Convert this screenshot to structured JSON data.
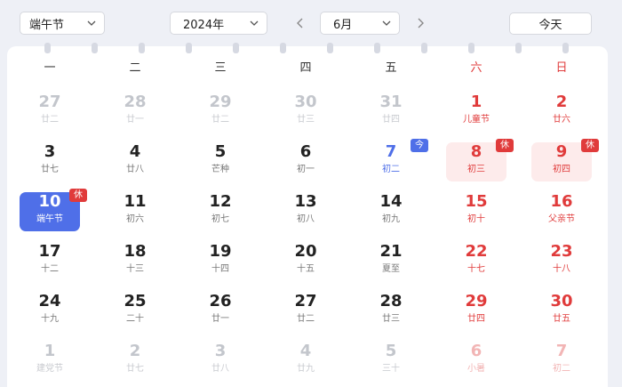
{
  "toolbar": {
    "holiday_select": {
      "value": "端午节"
    },
    "year_select": {
      "value": "2024年"
    },
    "month_select": {
      "value": "6月"
    },
    "prev_icon": "chevron-left-icon",
    "next_icon": "chevron-right-icon",
    "today_label": "今天"
  },
  "weekdays": [
    "一",
    "二",
    "三",
    "四",
    "五",
    "六",
    "日"
  ],
  "colors": {
    "accent": "#4f6fe8",
    "weekend": "#e03b3b",
    "rest_bg": "#fdebeb"
  },
  "days": [
    {
      "num": "27",
      "sub": "廿二",
      "other": true
    },
    {
      "num": "28",
      "sub": "廿一",
      "other": true
    },
    {
      "num": "29",
      "sub": "廿二",
      "other": true
    },
    {
      "num": "30",
      "sub": "廿三",
      "other": true
    },
    {
      "num": "31",
      "sub": "廿四",
      "other": true
    },
    {
      "num": "1",
      "sub": "儿童节",
      "weekend": true
    },
    {
      "num": "2",
      "sub": "廿六",
      "weekend": true
    },
    {
      "num": "3",
      "sub": "廿七"
    },
    {
      "num": "4",
      "sub": "廿八"
    },
    {
      "num": "5",
      "sub": "芒种"
    },
    {
      "num": "6",
      "sub": "初一"
    },
    {
      "num": "7",
      "sub": "初二",
      "work": true,
      "badge": "今"
    },
    {
      "num": "8",
      "sub": "初三",
      "weekend": true,
      "rest": true,
      "badge": "休"
    },
    {
      "num": "9",
      "sub": "初四",
      "weekend": true,
      "rest": true,
      "badge": "休"
    },
    {
      "num": "10",
      "sub": "端午节",
      "selected": true,
      "badge": "休"
    },
    {
      "num": "11",
      "sub": "初六"
    },
    {
      "num": "12",
      "sub": "初七"
    },
    {
      "num": "13",
      "sub": "初八"
    },
    {
      "num": "14",
      "sub": "初九"
    },
    {
      "num": "15",
      "sub": "初十",
      "weekend": true
    },
    {
      "num": "16",
      "sub": "父亲节",
      "weekend": true
    },
    {
      "num": "17",
      "sub": "十二"
    },
    {
      "num": "18",
      "sub": "十三"
    },
    {
      "num": "19",
      "sub": "十四"
    },
    {
      "num": "20",
      "sub": "十五"
    },
    {
      "num": "21",
      "sub": "夏至"
    },
    {
      "num": "22",
      "sub": "十七",
      "weekend": true
    },
    {
      "num": "23",
      "sub": "十八",
      "weekend": true
    },
    {
      "num": "24",
      "sub": "十九"
    },
    {
      "num": "25",
      "sub": "二十"
    },
    {
      "num": "26",
      "sub": "廿一"
    },
    {
      "num": "27",
      "sub": "廿二"
    },
    {
      "num": "28",
      "sub": "廿三"
    },
    {
      "num": "29",
      "sub": "廿四",
      "weekend": true
    },
    {
      "num": "30",
      "sub": "廿五",
      "weekend": true
    },
    {
      "num": "1",
      "sub": "建党节",
      "other": true
    },
    {
      "num": "2",
      "sub": "廿七",
      "other": true
    },
    {
      "num": "3",
      "sub": "廿八",
      "other": true
    },
    {
      "num": "4",
      "sub": "廿九",
      "other": true
    },
    {
      "num": "5",
      "sub": "三十",
      "other": true
    },
    {
      "num": "6",
      "sub": "小暑",
      "other": true,
      "weekend": true
    },
    {
      "num": "7",
      "sub": "初二",
      "other": true,
      "weekend": true
    }
  ]
}
